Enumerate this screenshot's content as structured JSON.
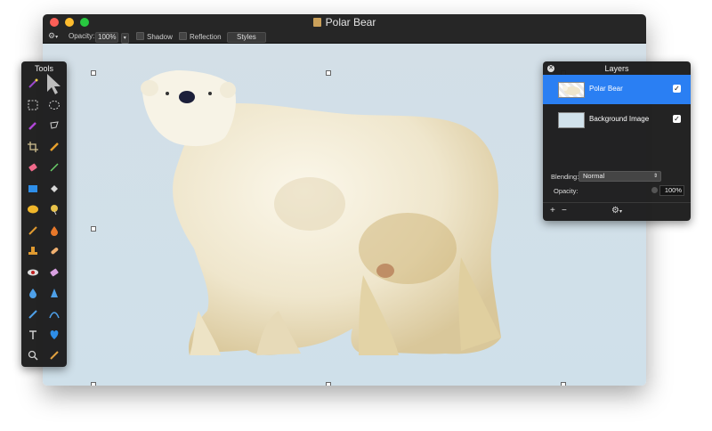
{
  "window": {
    "title": "Polar Bear",
    "traffic_lights": [
      {
        "name": "close",
        "color": "#fc5f57"
      },
      {
        "name": "minimize",
        "color": "#fdbc2e"
      },
      {
        "name": "zoom",
        "color": "#28c840"
      }
    ]
  },
  "toolbar": {
    "gear_icon": "gear-icon",
    "opacity_label": "Opacity:",
    "opacity_value": "100%",
    "shadow_label": "Shadow",
    "reflection_label": "Reflection",
    "styles_label": "Styles"
  },
  "tools_panel": {
    "title": "Tools",
    "tools": [
      "magic-wand-icon",
      "pointer-arrow-icon",
      "rect-select-icon",
      "ellipse-select-icon",
      "color-picker-icon",
      "lasso-icon",
      "crop-icon",
      "pencil-icon",
      "eraser-icon",
      "line-icon",
      "rectangle-icon",
      "fill-icon",
      "ellipse-shape-icon",
      "gradient-icon",
      "brush-icon",
      "smudge-icon",
      "stamp-icon",
      "heal-icon",
      "red-eye-icon",
      "eraser-alt-icon",
      "blur-drop-icon",
      "sharpen-icon",
      "pen-icon",
      "bezier-icon",
      "text-icon",
      "heart-shape-icon",
      "zoom-icon",
      "color-swatch-icon"
    ]
  },
  "layers_panel": {
    "title": "Layers",
    "layers": [
      {
        "name": "Polar Bear",
        "selected": true,
        "visible": true
      },
      {
        "name": "Background Image",
        "selected": false,
        "visible": true
      }
    ],
    "blending_label": "Blending:",
    "blending_value": "Normal",
    "opacity_label": "Opacity:",
    "opacity_value": "100%",
    "add_label": "+",
    "remove_label": "−"
  },
  "colors": {
    "accent": "#2a7ff3",
    "panel": "#1c1c1c",
    "canvas_bg": "#d1dfe8"
  }
}
